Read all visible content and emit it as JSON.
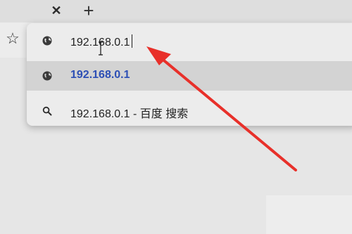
{
  "tab_strip": {
    "close_glyph": "✕",
    "new_tab_glyph": "+"
  },
  "toolbar": {
    "bookmark_icon": "star-outline-icon",
    "bookmark_glyph": "☆"
  },
  "omnibox": {
    "input_value": "192.168.0.1",
    "suggestions": [
      {
        "icon": "globe-icon",
        "text": "192.168.0.1",
        "highlighted": true
      },
      {
        "icon": "search-icon",
        "text": "192.168.0.1 - 百度 搜索",
        "highlighted": false
      }
    ]
  },
  "annotation": {
    "color": "#e8302a"
  },
  "colors": {
    "link_blue": "#2d4fb5",
    "highlight_row": "#d3d3d3",
    "dropdown_bg": "#ececec"
  }
}
